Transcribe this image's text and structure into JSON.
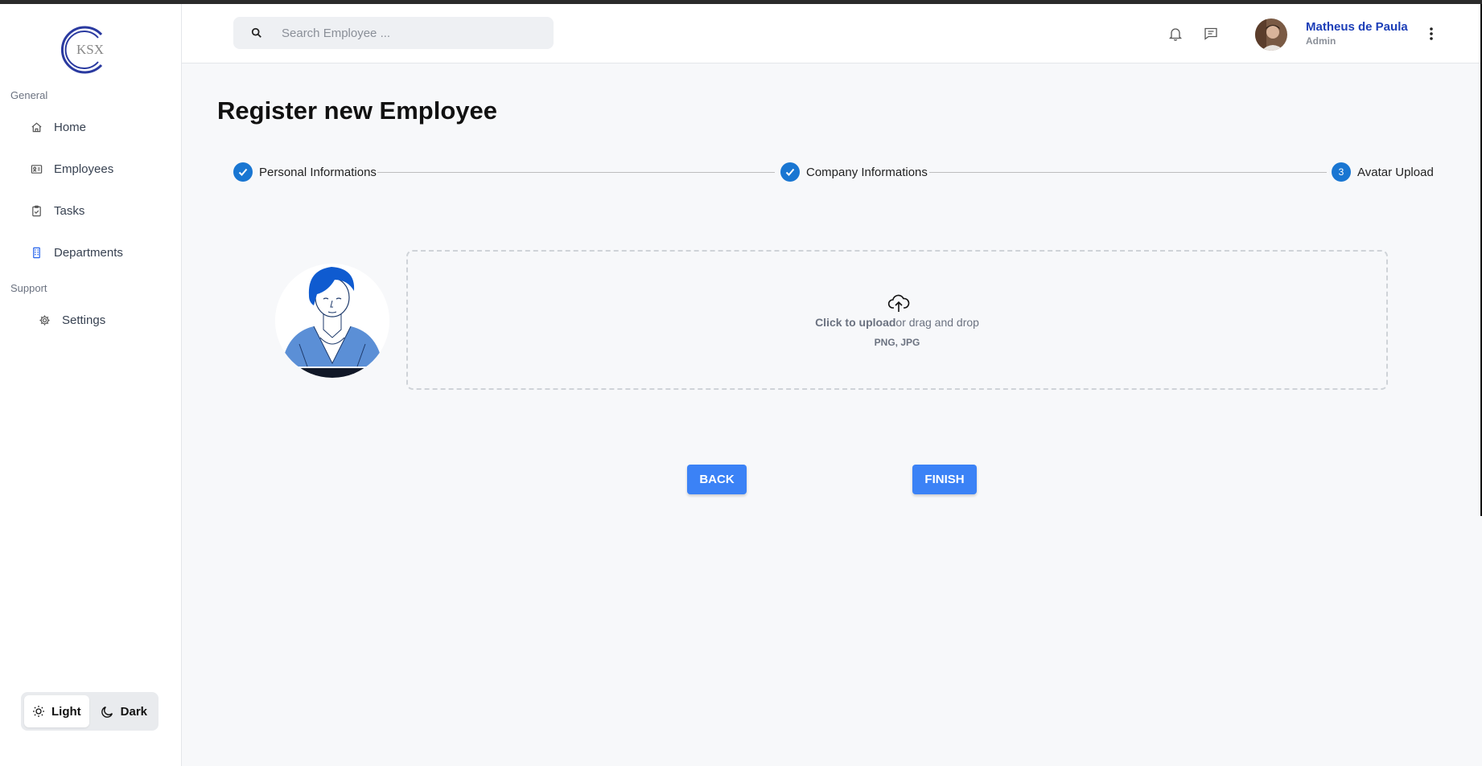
{
  "brand": {
    "logo_text": "KSX"
  },
  "sidebar": {
    "general_label": "General",
    "support_label": "Support",
    "items": [
      {
        "label": "Home",
        "icon": "home-icon"
      },
      {
        "label": "Employees",
        "icon": "id-card-icon"
      },
      {
        "label": "Tasks",
        "icon": "clipboard-check-icon"
      },
      {
        "label": "Departments",
        "icon": "building-icon"
      },
      {
        "label": "Settings",
        "icon": "gear-icon"
      }
    ],
    "theme": {
      "light_label": "Light",
      "dark_label": "Dark",
      "selected": "Light"
    }
  },
  "header": {
    "search_placeholder": "Search Employee ...",
    "user_name": "Matheus de Paula",
    "user_role": "Admin"
  },
  "main": {
    "title": "Register new Employee",
    "steps": [
      {
        "label": "Personal Informations",
        "status": "completed"
      },
      {
        "label": "Company Informations",
        "status": "completed"
      },
      {
        "label": "Avatar Upload",
        "number": "3",
        "status": "active"
      }
    ],
    "upload": {
      "click_text": "Click to upload",
      "drag_text": "or drag and drop",
      "formats": "PNG, JPG"
    },
    "back_label": "BACK",
    "finish_label": "FINISH"
  },
  "colors": {
    "accent": "#1976d2",
    "button": "#3b82f6",
    "user_name": "#1d3fb8"
  }
}
